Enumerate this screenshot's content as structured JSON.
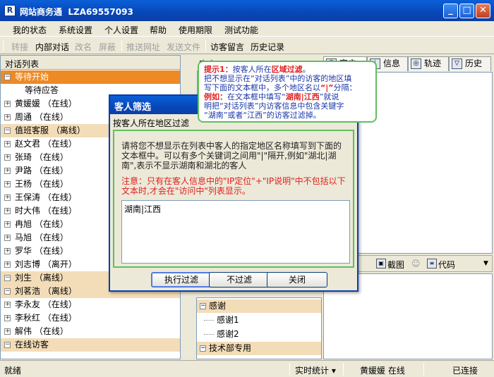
{
  "window": {
    "title": "网站商务通  LZA69557093"
  },
  "menu": [
    "我的状态",
    "系统设置",
    "个人设置",
    "帮助",
    "使用期限",
    "测试功能"
  ],
  "toolbar": {
    "items": [
      {
        "label": "转接",
        "enabled": false
      },
      {
        "label": "内部对话",
        "enabled": true
      },
      {
        "label": "改名",
        "enabled": false
      },
      {
        "label": "屏蔽",
        "enabled": false
      },
      {
        "label": "推送网址",
        "enabled": false
      },
      {
        "label": "发送文件",
        "enabled": false
      },
      {
        "label": "访客留言",
        "enabled": true
      },
      {
        "label": "历史记录",
        "enabled": true
      }
    ]
  },
  "left_panel": {
    "header": "对话列表",
    "rows": [
      {
        "type": "group",
        "label": "等待开始",
        "selected": true
      },
      {
        "type": "child",
        "label": "等待应答"
      },
      {
        "type": "user",
        "label": "黄媛媛 （在线）"
      },
      {
        "type": "user",
        "label": "周通 （在线）"
      },
      {
        "type": "group",
        "label": "值班客服 （离线）"
      },
      {
        "type": "user",
        "label": "赵文君 （在线）"
      },
      {
        "type": "user",
        "label": "张琦 （在线）"
      },
      {
        "type": "user",
        "label": "尹路 （在线）"
      },
      {
        "type": "user",
        "label": "王杨 （在线）"
      },
      {
        "type": "user",
        "label": "王保涛 （在线）"
      },
      {
        "type": "user",
        "label": "时大伟 （在线）"
      },
      {
        "type": "user",
        "label": "冉旭 （在线）"
      },
      {
        "type": "user",
        "label": "马旭 （在线）"
      },
      {
        "type": "user",
        "label": "罗华 （在线）"
      },
      {
        "type": "user",
        "label": "刘志博 （离开）"
      },
      {
        "type": "group",
        "label": "刘生 （离线）"
      },
      {
        "type": "group",
        "label": "刘茗浩 （离线）"
      },
      {
        "type": "user",
        "label": "李永友 （在线）"
      },
      {
        "type": "user",
        "label": "李秋红 （在线）"
      },
      {
        "type": "user",
        "label": "解伟 （在线）"
      },
      {
        "type": "group",
        "label": "在线访客"
      }
    ]
  },
  "visitor_header": "客户",
  "tabs": [
    {
      "label": "客户",
      "icon": "user-icon"
    },
    {
      "label": "信息",
      "icon": "info-icon"
    },
    {
      "label": "轨迹",
      "icon": "track-icon"
    },
    {
      "label": "历史",
      "icon": "history-icon"
    }
  ],
  "chat_toolbar": {
    "screenshot": "截图",
    "code": "代码"
  },
  "phrases": {
    "rows": [
      {
        "type": "group",
        "label": "感谢"
      },
      {
        "type": "child",
        "label": "感谢1"
      },
      {
        "type": "child",
        "label": "感谢2"
      },
      {
        "type": "group",
        "label": "技术部专用"
      }
    ]
  },
  "statusbar": {
    "ready": "就绪",
    "stats": "实时统计 ▾",
    "user": "黄媛媛 在线",
    "conn": "已连接"
  },
  "dialog": {
    "title": "客人筛选",
    "subtitle": "按客人所在地区过滤",
    "description": "请将您不想显示在列表中客人的指定地区名称填写到下面的文本框中。可以有多个关键词之间用\"|\"隔开,例如\"湖北|湖南\",表示不显示湖南和湖北的客人",
    "note": "注意：只有在客人信息中的\"IP定位\"+\"IP说明\"中不包括以下文本时,才会在\"访问中\"列表显示。",
    "input_value": "湖南|江西",
    "buttons": {
      "apply": "执行过滤",
      "no_filter": "不过滤",
      "close": "关闭"
    }
  },
  "tooltip": {
    "l1a": "提示1：",
    "l1b": "按客人所在",
    "l1c": "区域过滤",
    "l1d": "。",
    "l2": "把不想显示在“对话列表”中的访客的地区填",
    "l3a": "写下面的文本框中，多个地区名以",
    "l3b": "“|”",
    "l3c": "分隔：",
    "l4a": "例如：",
    "l4b": "在文本框中填写“",
    "l4c": "湖南|江西",
    "l4d": "”就说",
    "l5": "明把“对话列表”内访客信息中包含关键字",
    "l6": "“湖南”或者“江西”的访客过滤掉。"
  },
  "colors": {
    "accent": "#0a47b8",
    "group_bg": "#f3ddb8",
    "selected_bg": "#ed8a24",
    "tip_border": "#5fbf5f",
    "note_red": "#e02020"
  }
}
